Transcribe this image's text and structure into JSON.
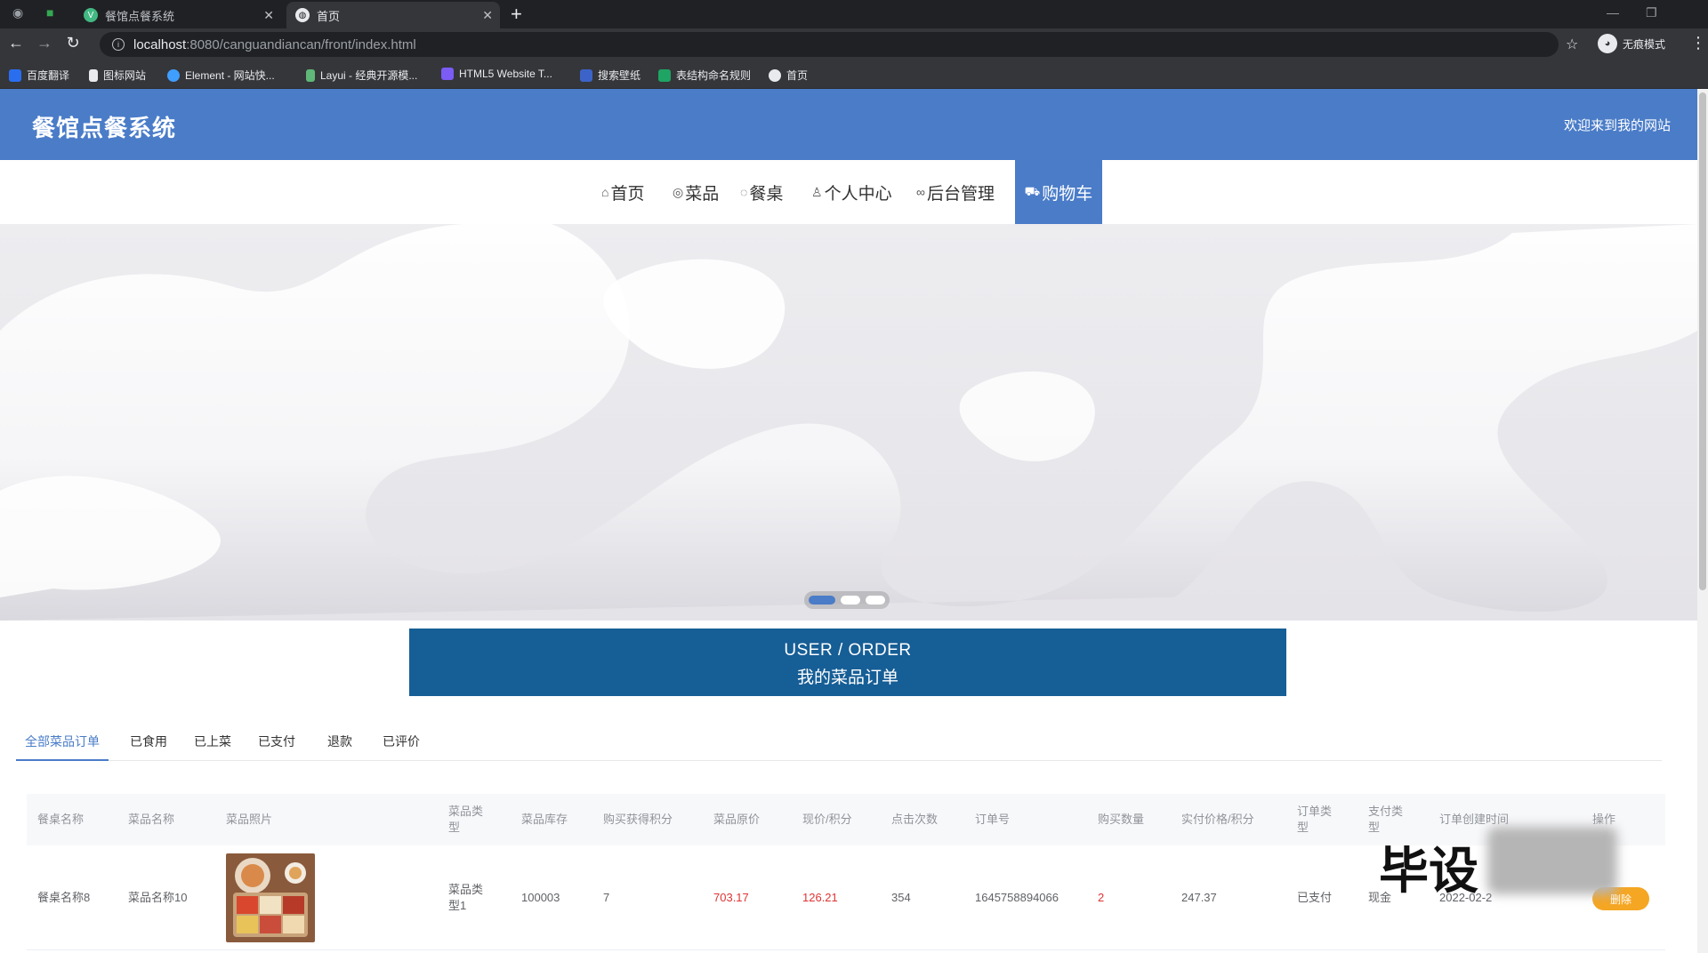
{
  "browser": {
    "tabs": [
      {
        "title": "餐馆点餐系统",
        "active": false
      },
      {
        "title": "首页",
        "active": true
      }
    ],
    "url_host": "localhost",
    "url_path": ":8080/canguandiancan/front/index.html",
    "profile_label": "无痕模式",
    "bookmarks": [
      "百度翻译",
      "图标网站",
      "Element - 网站快...",
      "Layui - 经典开源模...",
      "HTML5 Website T...",
      "搜索壁纸",
      "表结构命名规则",
      "首页"
    ]
  },
  "header": {
    "site_title": "餐馆点餐系统",
    "welcome": "欢迎来到我的网站"
  },
  "menu": [
    {
      "icon": "home-icon",
      "label": "首页"
    },
    {
      "icon": "dish-icon",
      "label": "菜品"
    },
    {
      "icon": "table-icon",
      "label": "餐桌"
    },
    {
      "icon": "user-icon",
      "label": "个人中心"
    },
    {
      "icon": "link-icon",
      "label": "后台管理"
    },
    {
      "icon": "cart-icon",
      "label": "购物车",
      "active": true
    }
  ],
  "section": {
    "en": "USER / ORDER",
    "cn": "我的菜品订单"
  },
  "order_tabs": [
    {
      "label": "全部菜品订单",
      "active": true
    },
    {
      "label": "已食用"
    },
    {
      "label": "已上菜"
    },
    {
      "label": "已支付"
    },
    {
      "label": "退款"
    },
    {
      "label": "已评价"
    }
  ],
  "table": {
    "headers": [
      "餐桌名称",
      "菜品名称",
      "菜品照片",
      "菜品类型",
      "菜品库存",
      "购买获得积分",
      "菜品原价",
      "现价/积分",
      "点击次数",
      "订单号",
      "购买数量",
      "实付价格/积分",
      "订单类型",
      "支付类型",
      "订单创建时间",
      "操作"
    ],
    "rows": [
      {
        "table_name": "餐桌名称8",
        "dish_name": "菜品名称10",
        "dish_type": "菜品类型1",
        "stock": "100003",
        "points": "7",
        "original_price": "703.17",
        "current_price": "126.21",
        "clicks": "354",
        "order_no": "1645758894066",
        "quantity": "2",
        "paid": "247.37",
        "order_type": "已支付",
        "pay_type": "现金",
        "created": "2022-02-2",
        "action": "删除"
      }
    ]
  },
  "watermark": "毕设",
  "colors": {
    "primary": "#4a7cc8",
    "section_bar": "#165e96",
    "price_red": "#e03333",
    "action_orange": "#f5a623"
  }
}
